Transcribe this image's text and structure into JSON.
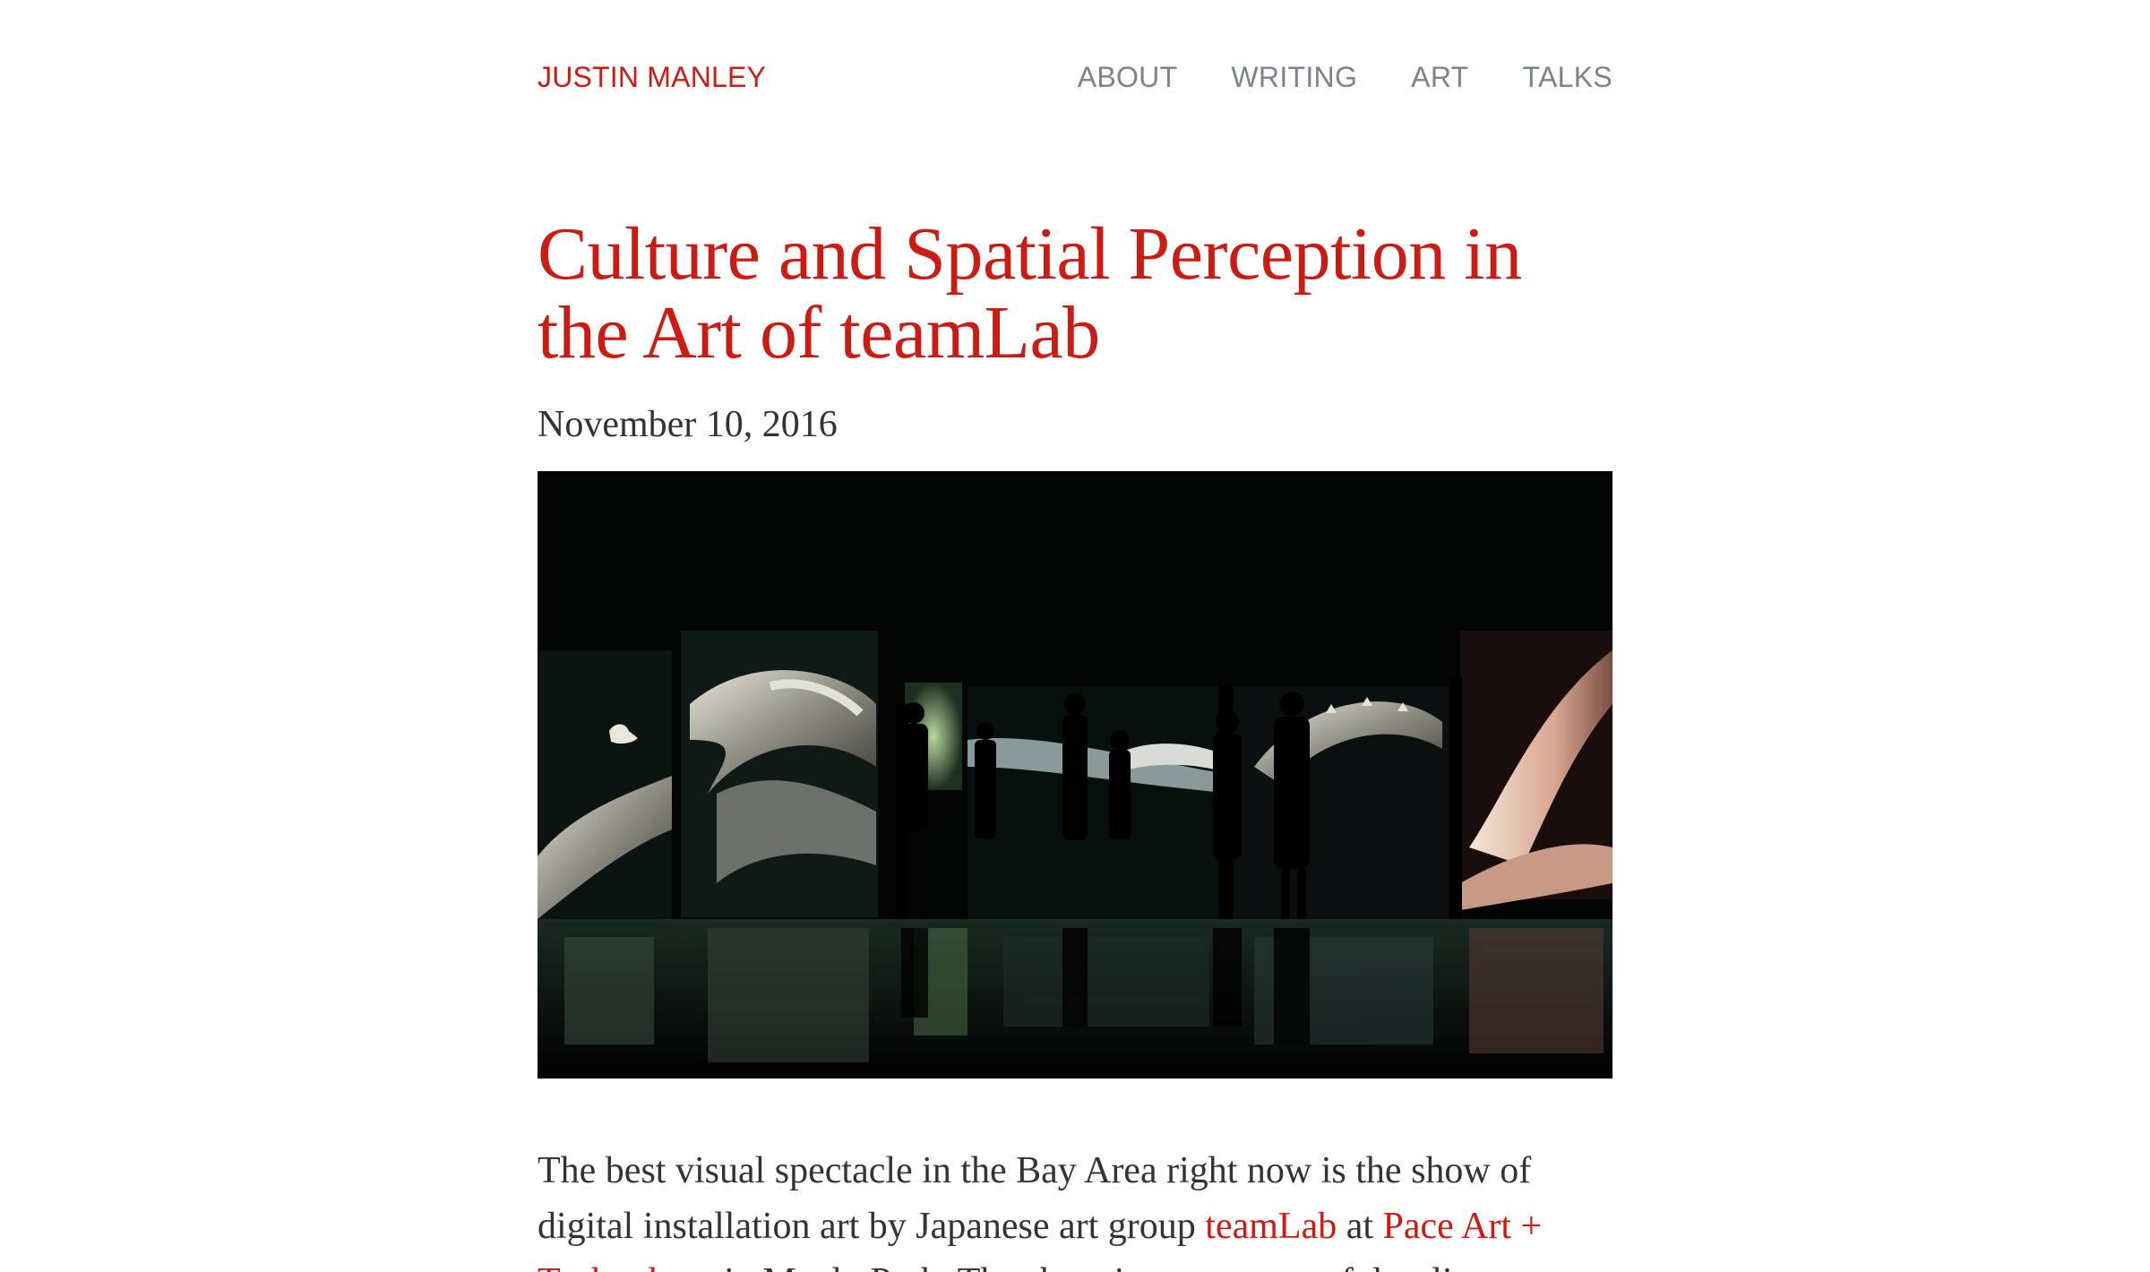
{
  "header": {
    "site_title": "JUSTIN MANLEY",
    "nav": [
      {
        "label": "ABOUT"
      },
      {
        "label": "WRITING"
      },
      {
        "label": "ART"
      },
      {
        "label": "TALKS"
      }
    ]
  },
  "post": {
    "title": "Culture and Spatial Perception in the Art of teamLab",
    "date": "November 10, 2016",
    "body": {
      "intro": "The best visual spectacle in the Bay Area right now is the show of digital installation art by Japanese art group ",
      "link1": "teamLab",
      "mid": " at ",
      "link2": "Pace Art + Technology",
      "tail": " in Menlo Park. The show is a sequence of dazzling"
    }
  },
  "colors": {
    "accent": "#cc1b13",
    "nav_text": "#7a838c",
    "body_text": "#333333",
    "background": "#ffffff"
  }
}
